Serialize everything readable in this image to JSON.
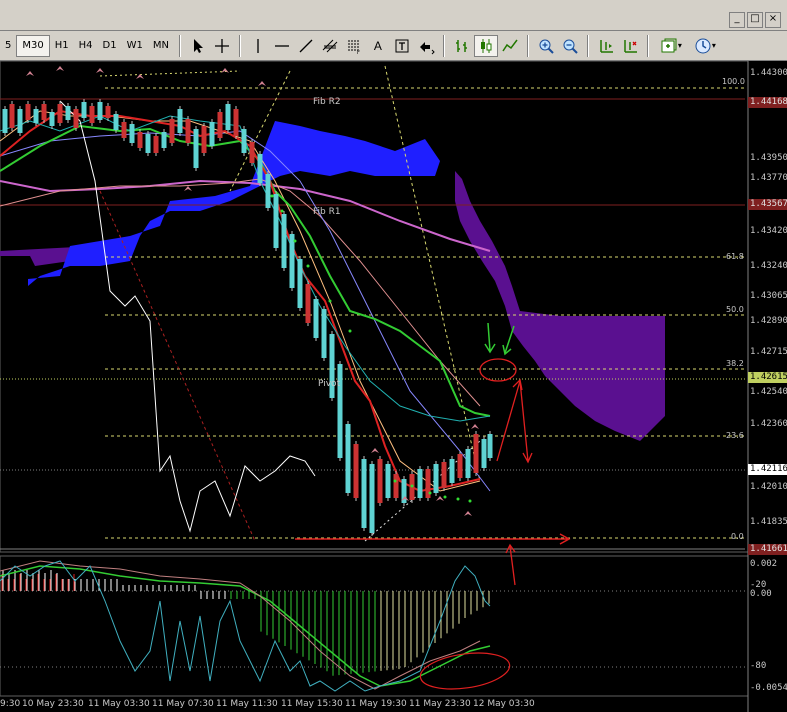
{
  "window": {
    "controls": [
      "_",
      "□",
      "×"
    ]
  },
  "toolbar": {
    "timeframes": [
      "5",
      "M30",
      "H1",
      "H4",
      "D1",
      "W1",
      "MN"
    ],
    "active_timeframe": "M30",
    "text_tool": "A",
    "icons": [
      "cursor-arrow-icon",
      "crosshair-icon",
      "vertical-line-icon",
      "horizontal-line-icon",
      "trendline-icon",
      "equidistant-channel-icon",
      "fibonacci-icon",
      "text-icon",
      "label-icon",
      "arrows-icon",
      "bar-chart-icon",
      "candlestick-icon",
      "line-chart-icon",
      "zoom-in-icon",
      "zoom-out-icon",
      "chart-shift-icon",
      "autoscroll-icon",
      "indicators-icon",
      "periodicity-icon"
    ]
  },
  "price_axis": {
    "labels": [
      "1.44300",
      "1.43950",
      "1.43770",
      "1.43420",
      "1.43240",
      "1.43065",
      "1.42890",
      "1.42715",
      "1.42540",
      "1.42360",
      "1.42010",
      "1.41835"
    ],
    "badges": [
      {
        "text": "1.44168",
        "bg": "#7f2020",
        "fg": "#e0e0e0"
      },
      {
        "text": "1.43567",
        "bg": "#7f2020",
        "fg": "#e0e0e0"
      },
      {
        "text": "1.42615",
        "bg": "#c0d060",
        "fg": "#000000"
      },
      {
        "text": "1.42116",
        "bg": "#ffffff",
        "fg": "#000000"
      },
      {
        "text": "1.41661",
        "bg": "#7f2020",
        "fg": "#e0e0e0"
      }
    ]
  },
  "fib_levels": [
    {
      "text": "100.0"
    },
    {
      "text": "61.8"
    },
    {
      "text": "50.0"
    },
    {
      "text": "38.2"
    },
    {
      "text": "23.6"
    },
    {
      "text": "0.0"
    }
  ],
  "chart_objects": [
    "Fib R2",
    "Fib R1",
    "Pivot"
  ],
  "oscillator_axis": [
    "0.002",
    "-20",
    "0.00",
    "-80",
    "-0.0054"
  ],
  "time_axis": [
    "9:30",
    "10 May 23:30",
    "11 May 03:30",
    "11 May 07:30",
    "11 May 11:30",
    "11 May 15:30",
    "11 May 19:30",
    "11 May 23:30",
    "12 May 03:30"
  ],
  "colors": {
    "background": "#000000",
    "bull_candle": "#5fd3d3",
    "bear_candle": "#cc3333",
    "ichimoku_cloud_bull": "#1f1fff",
    "ichimoku_cloud_bear": "#5a1090",
    "annotation_red": "#e02020",
    "annotation_green": "#33cc33",
    "fib_line": "#d8d870"
  }
}
